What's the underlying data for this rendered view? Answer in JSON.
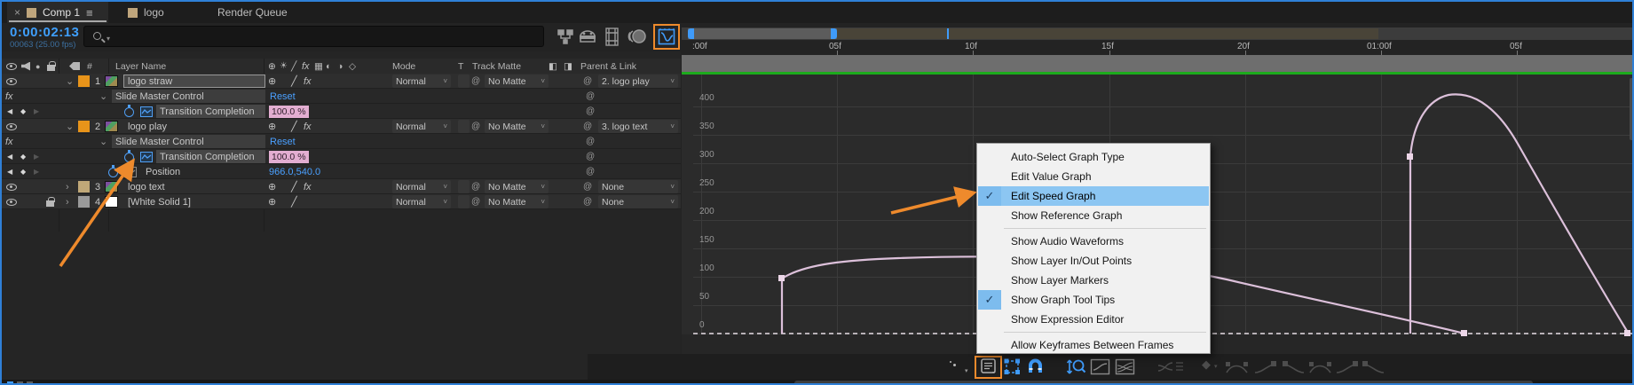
{
  "tabs": {
    "comp": "Comp 1",
    "logo": "logo",
    "render_queue": "Render Queue"
  },
  "timecode": {
    "main": "0:00:02:13",
    "sub": "00063 (25.00 fps)"
  },
  "columns": {
    "hash": "#",
    "layer_name": "Layer Name",
    "mode": "Mode",
    "t": "T",
    "track_matte": "Track Matte",
    "parent_link": "Parent & Link"
  },
  "rows": {
    "r1": {
      "num": "1",
      "name": "logo straw",
      "mode": "Normal",
      "matte": "No Matte",
      "parent": "2. logo play"
    },
    "r2": {
      "name": "Slide Master Control",
      "value": "Reset"
    },
    "r3": {
      "name": "Transition Completion",
      "value": "100.0 %"
    },
    "r4": {
      "num": "2",
      "name": "logo play",
      "mode": "Normal",
      "matte": "No Matte",
      "parent": "3. logo text"
    },
    "r5": {
      "name": "Slide Master Control",
      "value": "Reset"
    },
    "r6": {
      "name": "Transition Completion",
      "value": "100.0 %"
    },
    "r7": {
      "name": "Position",
      "value": "966.0,540.0"
    },
    "r8": {
      "num": "3",
      "name": "logo text",
      "mode": "Normal",
      "matte": "No Matte",
      "parent": "None"
    },
    "r9": {
      "num": "4",
      "name": "[White Solid 1]",
      "mode": "Normal",
      "matte": "No Matte",
      "parent": "None"
    }
  },
  "ruler": {
    "labels": [
      ":00f",
      "05f",
      "10f",
      "15f",
      "20f",
      "01:00f",
      "05f"
    ]
  },
  "graph": {
    "y_labels": [
      "400",
      "350",
      "300",
      "250",
      "200",
      "150",
      "100",
      "50",
      "0"
    ],
    "type": "speed-graph",
    "curve_color": "#dcc0da",
    "zero_line": "dashed"
  },
  "menu": {
    "items": [
      {
        "label": "Auto-Select Graph Type",
        "checked": false
      },
      {
        "label": "Edit Value Graph",
        "checked": false
      },
      {
        "label": "Edit Speed Graph",
        "checked": true,
        "highlighted": true
      },
      {
        "label": "Show Reference Graph",
        "checked": false
      },
      {
        "label": "Show Audio Waveforms",
        "checked": false
      },
      {
        "label": "Show Layer In/Out Points",
        "checked": false
      },
      {
        "label": "Show Layer Markers",
        "checked": false
      },
      {
        "label": "Show Graph Tool Tips",
        "checked": true
      },
      {
        "label": "Show Expression Editor",
        "checked": false
      },
      {
        "label": "Allow Keyframes Between Frames",
        "checked": false
      }
    ]
  },
  "icons": {
    "close": "×",
    "hamburger": "≡",
    "chev_down": "⌄",
    "chev_right": "›",
    "dd_arrow": "˅",
    "fx": "fx",
    "pin": "⊕",
    "slash": "╱",
    "sun": "☀",
    "grid": "▦",
    "moon1": "◐",
    "moon2": "◑",
    "cube": "◇",
    "pickwhip": "@",
    "kf_left": "◀",
    "kf_diamond": "◆",
    "kf_right": "▶",
    "check": "✓",
    "solo": "●",
    "matte_a": "◧",
    "matte_b": "◨",
    "diamond_dim": "◆"
  },
  "colors": {
    "accent_orange": "#ee8a2c",
    "accent_blue": "#3f9bfa",
    "render_green": "#1daa1d",
    "curve_pink": "#dcc0da",
    "value_pink_bg": "#e3aed1",
    "menu_highlight": "#8cc6f2"
  }
}
